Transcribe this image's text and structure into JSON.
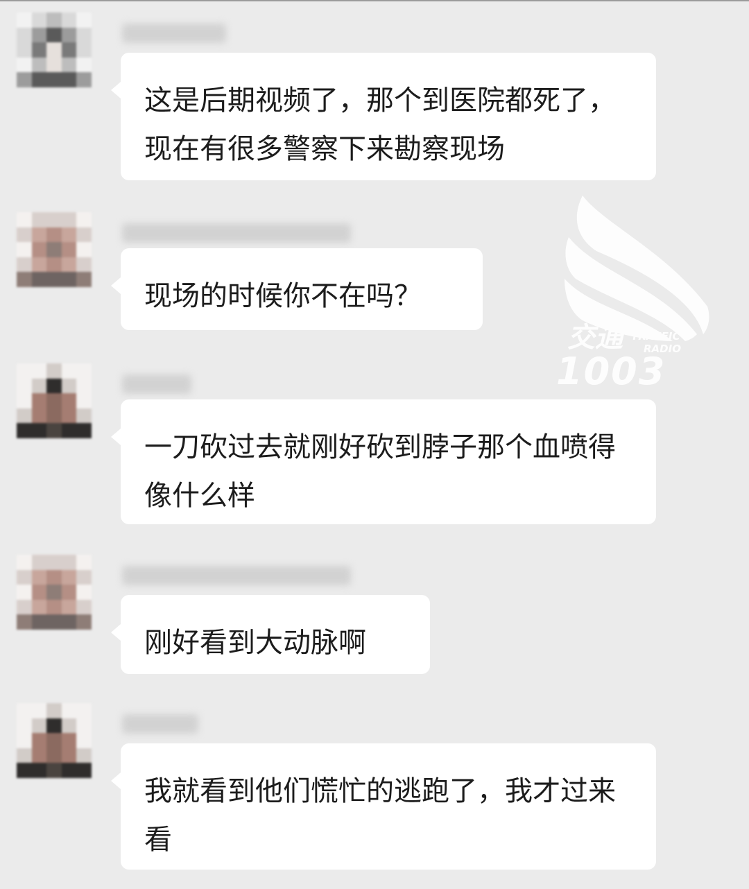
{
  "messages": [
    {
      "sender": "████",
      "text": "这是后期视频了，那个到医院都死了，现在有很多警察下来勘察现场",
      "avatar_palette": "gray"
    },
    {
      "sender": "██████████",
      "text": "现场的时候你不在吗？",
      "avatar_palette": "pink"
    },
    {
      "sender": "█████",
      "text": "一刀砍过去就刚好砍到脖子那个血喷得像什么样",
      "avatar_palette": "brown"
    },
    {
      "sender": "██████████",
      "text": "刚好看到大动脉啊",
      "avatar_palette": "pink"
    },
    {
      "sender": "████",
      "text": "我就看到他们慌忙的逃跑了，我才过来看",
      "avatar_palette": "brown"
    }
  ],
  "watermark": {
    "line1": "交通",
    "line2": "1003",
    "line3": "TRAFFIC",
    "line4": "RADIO",
    "icon": "wing-icon"
  },
  "colors": {
    "background": "#ebebeb",
    "bubble": "#ffffff",
    "text": "#1c1c1c"
  }
}
